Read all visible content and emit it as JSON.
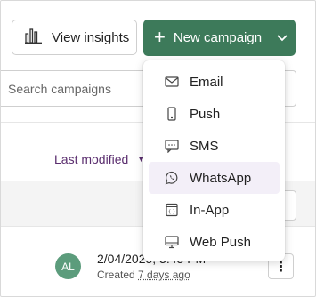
{
  "toolbar": {
    "view_insights_label": "View insights",
    "new_campaign_label": "New campaign"
  },
  "search": {
    "placeholder": "Search campaigns"
  },
  "sort": {
    "label": "Last modified"
  },
  "campaign_row": {
    "avatar_initials": "AL",
    "date": "2/04/2025, 3:45 PM",
    "created_prefix": "Created",
    "created_ago": "7 days ago"
  },
  "dropdown": {
    "items": [
      {
        "label": "Email",
        "icon": "mail-icon"
      },
      {
        "label": "Push",
        "icon": "phone-icon"
      },
      {
        "label": "SMS",
        "icon": "sms-icon"
      },
      {
        "label": "WhatsApp",
        "icon": "whatsapp-icon",
        "active": true
      },
      {
        "label": "In-App",
        "icon": "in-app-icon"
      },
      {
        "label": "Web Push",
        "icon": "monitor-icon"
      }
    ]
  },
  "colors": {
    "brand_green": "#3d7a5a",
    "sort_purple": "#5a2d6e",
    "avatar_green": "#5c9c7c",
    "menu_active_bg": "#f3eff8"
  }
}
